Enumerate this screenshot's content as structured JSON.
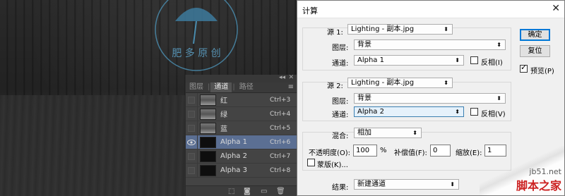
{
  "watermark": {
    "text": "肥 多 原 创"
  },
  "channels_panel": {
    "tabs": [
      {
        "label": "图层"
      },
      {
        "label": "通道",
        "active": true
      },
      {
        "label": "路径"
      }
    ],
    "rows": [
      {
        "name": "红",
        "shortcut": "Ctrl+3",
        "thumb": "light",
        "visible": false,
        "selected": false
      },
      {
        "name": "绿",
        "shortcut": "Ctrl+4",
        "thumb": "light",
        "visible": false,
        "selected": false
      },
      {
        "name": "蓝",
        "shortcut": "Ctrl+5",
        "thumb": "light",
        "visible": false,
        "selected": false
      },
      {
        "name": "Alpha 1",
        "shortcut": "Ctrl+6",
        "thumb": "dark",
        "visible": true,
        "selected": true
      },
      {
        "name": "Alpha 2",
        "shortcut": "Ctrl+7",
        "thumb": "dark",
        "visible": false,
        "selected": false
      },
      {
        "name": "Alpha 3",
        "shortcut": "Ctrl+8",
        "thumb": "dark",
        "visible": false,
        "selected": false
      }
    ]
  },
  "dialog": {
    "title": "计算",
    "source1": {
      "label": "源 1:",
      "file": "Lighting - 副本.jpg",
      "layer_label": "图层:",
      "layer": "背景",
      "channel_label": "通道:",
      "channel": "Alpha 1",
      "invert_label": "反相(I)",
      "invert": false
    },
    "source2": {
      "label": "源 2:",
      "file": "Lighting - 副本.jpg",
      "layer_label": "图层:",
      "layer": "背景",
      "channel_label": "通道:",
      "channel": "Alpha 2",
      "invert_label": "反相(V)",
      "invert": false
    },
    "blending": {
      "label": "混合:",
      "mode": "相加",
      "opacity_label": "不透明度(O):",
      "opacity": "100",
      "opacity_unit": "%",
      "offset_label": "补偿值(F):",
      "offset": "0",
      "scale_label": "缩放(E):",
      "scale": "1",
      "mask_label": "蒙版(K)...",
      "mask": false
    },
    "result": {
      "label": "结果:",
      "value": "新建通道"
    },
    "buttons": {
      "ok": "确定",
      "reset": "复位"
    },
    "preview": {
      "label": "预览(P)",
      "checked": true
    }
  },
  "site_watermark": {
    "line1": "jb51.net",
    "line2": "脚本之家"
  }
}
